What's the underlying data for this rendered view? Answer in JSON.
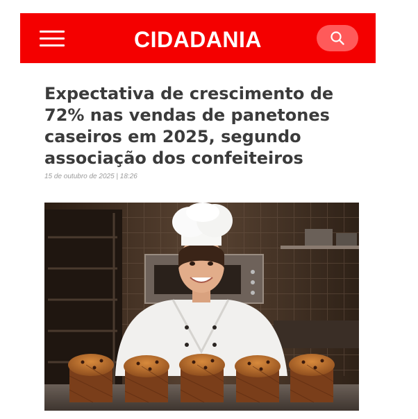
{
  "header": {
    "brand": "CIDADANIA",
    "menu_icon": "hamburger-menu-icon",
    "search_icon": "search-icon",
    "background_color": "#f40000",
    "search_button_color": "#ff5a5a"
  },
  "article": {
    "title": "Expectativa de crescimento de 72% nas vendas de panetones caseiros em 2025, segundo associação dos confeiteiros",
    "date": "15 de outubro de 2025 | 18:26",
    "photo": {
      "subject": "smiling chef in white uniform and toque behind five panettones in a bakery kitchen"
    }
  }
}
